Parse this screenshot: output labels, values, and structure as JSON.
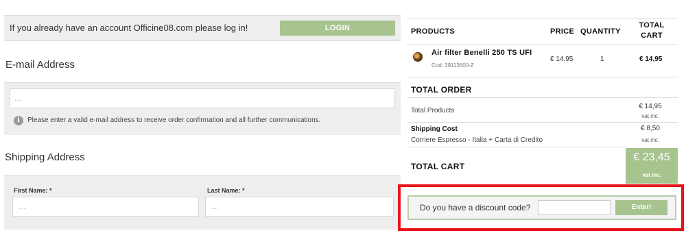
{
  "login": {
    "message": "If you already have an account Officine08.com please log in!",
    "button_label": "LOGIN"
  },
  "email_section": {
    "title": "E-mail Address",
    "input_placeholder": "....",
    "info_icon_glyph": "i",
    "info_text": "Please enter a valid e-mail address to receive order confirmation and all further communications."
  },
  "shipping_section": {
    "title": "Shipping Address",
    "first_name_label": "First Name: *",
    "first_name_placeholder": "....",
    "last_name_label": "Last Name: *",
    "last_name_placeholder": "...."
  },
  "cart": {
    "columns": {
      "products": "PRODUCTS",
      "price": "PRICE",
      "quantity": "QUANTITY",
      "total_line1": "TOTAL",
      "total_line2": "CART"
    },
    "items": [
      {
        "name": "Air filter Benelli 250 TS UFI",
        "code": "Cod: 39113600-Z",
        "price": "€ 14,95",
        "quantity": "1",
        "total": "€ 14,95",
        "thumbnail_icon": "air-filter-thumbnail"
      }
    ],
    "total_order_title": "TOTAL ORDER",
    "total_products_label": "Total Products",
    "total_products_value": "€ 14,95",
    "total_products_vat": "vat inc.",
    "shipping_cost_label": "Shipping Cost",
    "shipping_method": "Corriere Espresso - Italia + Carta di Credito",
    "shipping_cost_value": "€ 8,50",
    "shipping_cost_vat": "vat inc.",
    "total_cart_title": "TOTAL CART",
    "total_cart_value": "€ 23,45",
    "total_cart_vat": "vat inc."
  },
  "discount": {
    "label": "Do you have a discount code?",
    "input_value": "",
    "button_label": "Enter!"
  },
  "colors": {
    "accent_green": "#a7c48f",
    "highlight_red": "#e8141b",
    "panel_gray": "#eeeeee"
  }
}
